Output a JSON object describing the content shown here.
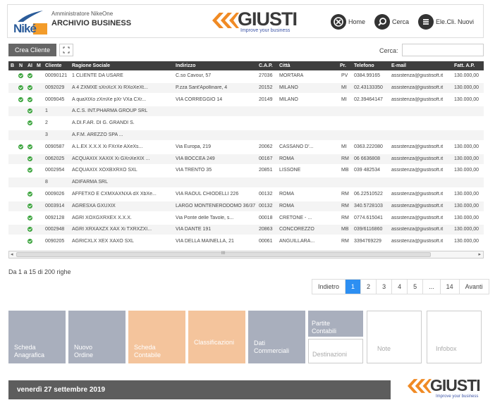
{
  "header": {
    "logo_text": "Niké",
    "subtitle": "Amministratore NikeOne",
    "title": "ARCHIVIO BUSINESS",
    "brand": "GIUSTI",
    "brand_tagline": "Improve your business",
    "nav": [
      {
        "label": "Home",
        "icon": "home-x-icon"
      },
      {
        "label": "Cerca",
        "icon": "search-icon"
      },
      {
        "label": "Ele.Cli. Nuovi",
        "icon": "list-icon"
      }
    ]
  },
  "toolbar": {
    "create_label": "Crea Cliente",
    "search_label": "Cerca:",
    "search_value": ""
  },
  "table": {
    "columns": [
      "B",
      "N",
      "AI",
      "M",
      "Cliente",
      "Ragione Sociale",
      "Indirizzo",
      "C.A.P.",
      "Città",
      "Pr.",
      "Telefono",
      "E-mail",
      "Fatt. A.P."
    ],
    "rows": [
      {
        "b": true,
        "n": true,
        "cliente": "00090121",
        "ragione": "1 CLIENTE DA USARE",
        "indirizzo": "C.so Cavour, 57",
        "cap": "27036",
        "citta": "MORTARA",
        "pr": "PV",
        "tel": "0384.99165",
        "email": "assistenza@giustisoft.it",
        "fatt": "130.000,00"
      },
      {
        "b": true,
        "n": true,
        "cliente": "0092029",
        "ragione": "A 4 ZXMXE sXnXcX Xi RXoXeXt...",
        "indirizzo": "P.zza Sant'Apollinare, 4",
        "cap": "20152",
        "citta": "MILANO",
        "pr": "MI",
        "tel": "02.43133350",
        "email": "assistenza@giustisoft.it",
        "fatt": "130.000,00"
      },
      {
        "b": true,
        "n": true,
        "cliente": "0009045",
        "ragione": "A quaXtXo zXmXe pXr VXa CXr...",
        "indirizzo": "VIA CORREGGIO 14",
        "cap": "20149",
        "citta": "MILANO",
        "pr": "MI",
        "tel": "02.39464147",
        "email": "assistenza@giustisoft.it",
        "fatt": "130.000,00"
      },
      {
        "b": false,
        "n": true,
        "cliente": "1",
        "ragione": "A.C.S. INT.PHARMA GROUP SRL",
        "indirizzo": "",
        "cap": "",
        "citta": "",
        "pr": "",
        "tel": "",
        "email": "",
        "fatt": ""
      },
      {
        "b": false,
        "n": true,
        "cliente": "2",
        "ragione": "A.DI.F.AR. DI G. GRANDI S.",
        "indirizzo": "",
        "cap": "",
        "citta": "",
        "pr": "",
        "tel": "",
        "email": "",
        "fatt": ""
      },
      {
        "b": false,
        "n": false,
        "cliente": "3",
        "ragione": "A.F.M. AREZZO SPA ...",
        "indirizzo": "",
        "cap": "",
        "citta": "",
        "pr": "",
        "tel": "",
        "email": "",
        "fatt": ""
      },
      {
        "b": true,
        "n": true,
        "cliente": "0090587",
        "ragione": "A.L.EX X.X.X Xi FXrXe AXeXs...",
        "indirizzo": "Via Europa, 219",
        "cap": "20062",
        "citta": "CASSANO D'...",
        "pr": "MI",
        "tel": "0363.222080",
        "email": "assistenza@giustisoft.it",
        "fatt": "130.000,00"
      },
      {
        "b": false,
        "n": true,
        "cliente": "0062025",
        "ragione": "ACQUAXIX XAXIX Xi GXnXeXIX ...",
        "indirizzo": "VIA BOCCEA 249",
        "cap": "00167",
        "citta": "ROMA",
        "pr": "RM",
        "tel": "06 6636808",
        "email": "assistenza@giustisoft.it",
        "fatt": "130.000,00"
      },
      {
        "b": false,
        "n": true,
        "cliente": "0002954",
        "ragione": "ACQUAXIX XOXBXRXO SXL",
        "indirizzo": "VIA TRENTO 35",
        "cap": "20851",
        "citta": "LISSONE",
        "pr": "MB",
        "tel": "039 482534",
        "email": "assistenza@giustisoft.it",
        "fatt": "130.000,00"
      },
      {
        "b": false,
        "n": false,
        "cliente": "8",
        "ragione": "ADIFARMA SRL",
        "indirizzo": "",
        "cap": "",
        "citta": "",
        "pr": "",
        "tel": "",
        "email": "",
        "fatt": ""
      },
      {
        "b": false,
        "n": true,
        "cliente": "0009026",
        "ragione": "AFFETXO E CXMXAXNXA dX XbXe...",
        "indirizzo": "VIA RAOUL CHIODELLI 226",
        "cap": "00132",
        "citta": "ROMA",
        "pr": "RM",
        "tel": "06.22510522",
        "email": "assistenza@giustisoft.it",
        "fatt": "130.000,00"
      },
      {
        "b": false,
        "n": true,
        "cliente": "0003914",
        "ragione": "AGRESXA GXUXIX",
        "indirizzo": "LARGO MONTENERODOMO 36/37...",
        "cap": "00132",
        "citta": "ROMA",
        "pr": "RM",
        "tel": "340.5728103",
        "email": "assistenza@giustisoft.it",
        "fatt": "130.000,00"
      },
      {
        "b": false,
        "n": true,
        "cliente": "0092128",
        "ragione": "AGRI XOXGXRXEX X.X.X.",
        "indirizzo": "Via Ponte delle Tavole, s...",
        "cap": "00018",
        "citta": "CRETONE - ...",
        "pr": "RM",
        "tel": "0774.615041",
        "email": "assistenza@giustisoft.it",
        "fatt": "130.000,00"
      },
      {
        "b": false,
        "n": true,
        "cliente": "0002948",
        "ragione": "AGRI XRXAXZX XAX Xi TXRXZXI...",
        "indirizzo": "VIA DANTE 191",
        "cap": "20863",
        "citta": "CONCOREZZO",
        "pr": "MB",
        "tel": "039/6116860",
        "email": "assistenza@giustisoft.it",
        "fatt": "130.000,00"
      },
      {
        "b": false,
        "n": true,
        "cliente": "0090205",
        "ragione": "AGRICXLX XEX XAXO SXL",
        "indirizzo": "VIA DELLA MAINELLA, 21",
        "cap": "00061",
        "citta": "ANGUILLARA...",
        "pr": "RM",
        "tel": "3394769229",
        "email": "assistenza@giustisoft.it",
        "fatt": "130.000,00"
      }
    ],
    "scroll_marker": "III"
  },
  "footer_info": "Da 1 a 15 di 200 righe",
  "pagination": [
    "Indietro",
    "1",
    "2",
    "3",
    "4",
    "5",
    "...",
    "14",
    "Avanti"
  ],
  "pagination_active": "1",
  "tiles": [
    {
      "label": "Scheda Anagrafica",
      "style": "grey"
    },
    {
      "label": "Nuovo Ordine",
      "style": "grey"
    },
    {
      "label": "Scheda Contabile",
      "style": "orange"
    },
    {
      "label": "Classificazioni",
      "style": "orange"
    },
    {
      "label": "Dati Commerciali",
      "style": "grey"
    },
    {
      "label": "Partite Contabili",
      "style": "grey"
    },
    {
      "label": "Destinazioni",
      "style": "outline"
    },
    {
      "label": "Note",
      "style": "outline"
    },
    {
      "label": "Infobox",
      "style": "outline"
    }
  ],
  "date_label": "venerdì 27 settembre 2019",
  "colors": {
    "accent": "#2d8ff2",
    "check": "#39a33b",
    "header_bg": "#3e3e3e",
    "tile_grey": "#a9afbd",
    "tile_orange": "#f4c49c"
  }
}
